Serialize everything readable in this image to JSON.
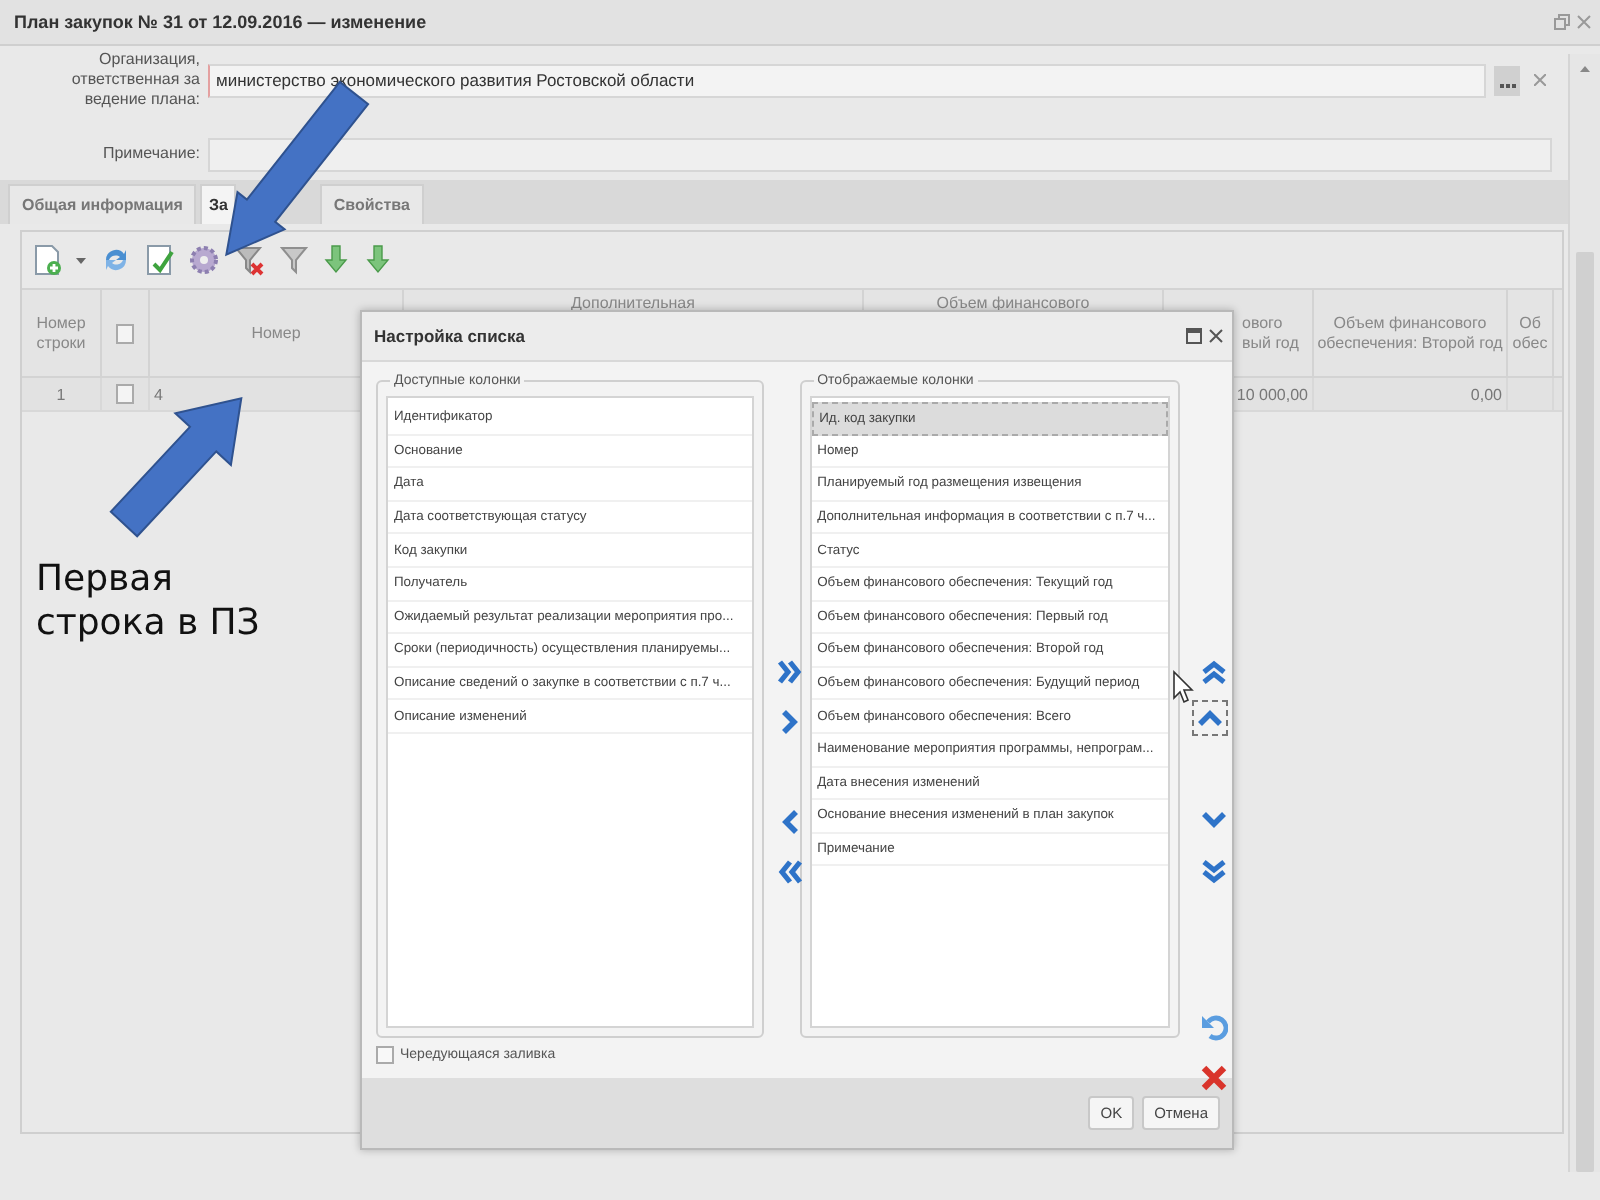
{
  "window": {
    "title": "План закупок № 31 от 12.09.2016 — изменение"
  },
  "form": {
    "fields": [
      {
        "label": "Организация, ответственная за ведение плана:",
        "value": "министерство экономического развития Ростовской области"
      },
      {
        "label": "Примечание:"
      }
    ]
  },
  "tabs": [
    {
      "label": "Общая информация",
      "selected": false
    },
    {
      "label": "За",
      "selected": true
    },
    {
      "label": "Свойства",
      "selected": false
    }
  ],
  "grid": {
    "header_checked": false,
    "columns": [
      "Номер строки",
      "Номер",
      "Дополнительная",
      "Объем финансового",
      "ового вый год",
      "Объем финансового обеспечения: Второй год",
      "Об обес"
    ],
    "rows": [
      {
        "checked": false,
        "cells": [
          "1",
          "4",
          "",
          "",
          "10 000,00",
          "0,00",
          ""
        ]
      }
    ]
  },
  "dialog": {
    "title": "Настройка списка",
    "available": {
      "legend": "Доступные колонки",
      "items": [
        "Идентификатор",
        "Основание",
        "Дата",
        "Дата соответствующая статусу",
        "Код закупки",
        "Получатель",
        "Ожидаемый результат реализации мероприятия про...",
        "Сроки (периодичность) осуществления планируемы...",
        "Описание сведений о закупке в соответствии с п.7 ч...",
        "Описание изменений"
      ]
    },
    "displayed": {
      "legend": "Отображаемые колонки",
      "items": [
        {
          "label": "Ид. код закупки",
          "selected": true
        },
        {
          "label": "Номер",
          "selected": false
        },
        {
          "label": "Планируемый год размещения извещения",
          "selected": false
        },
        {
          "label": "Дополнительная информация в соответствии с п.7 ч...",
          "selected": false
        },
        {
          "label": "Статус",
          "selected": false
        },
        {
          "label": "Объем финансового обеспечения: Текущий год",
          "selected": false
        },
        {
          "label": "Объем финансового обеспечения: Первый год",
          "selected": false
        },
        {
          "label": "Объем финансового обеспечения: Второй год",
          "selected": false
        },
        {
          "label": "Объем финансового обеспечения: Будущий период",
          "selected": false
        },
        {
          "label": "Объем финансового обеспечения: Всего",
          "selected": false
        },
        {
          "label": "Наименование мероприятия программы, непрограм...",
          "selected": false
        },
        {
          "label": "Дата внесения изменений",
          "selected": false
        },
        {
          "label": "Основание внесения изменений в план закупок",
          "selected": false
        },
        {
          "label": "Примечание",
          "selected": false
        }
      ]
    },
    "alternate_fill": {
      "label": "Чередующаяся заливка",
      "checked": false
    },
    "buttons": [
      "OK",
      "Отмена"
    ]
  },
  "annotation": {
    "text": "Первая строка в ПЗ"
  }
}
